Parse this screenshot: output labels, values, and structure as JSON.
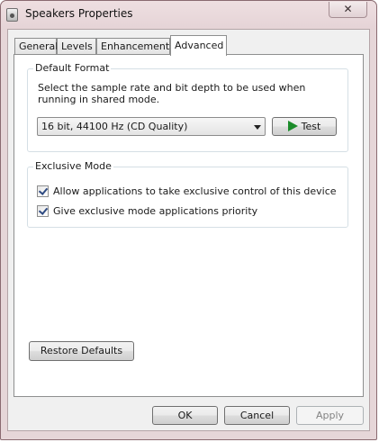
{
  "window": {
    "title": "Speakers Properties",
    "close_glyph": "✕"
  },
  "tabs": [
    {
      "label": "General",
      "active": false
    },
    {
      "label": "Levels",
      "active": false
    },
    {
      "label": "Enhancements",
      "active": false
    },
    {
      "label": "Advanced",
      "active": true
    }
  ],
  "default_format": {
    "heading": "Default Format",
    "description": "Select the sample rate and bit depth to be used when running in shared mode.",
    "selected_format": "16 bit, 44100 Hz (CD Quality)",
    "test_label": "Test",
    "test_icon": "play-icon"
  },
  "exclusive_mode": {
    "heading": "Exclusive Mode",
    "options": [
      {
        "label": "Allow applications to take exclusive control of this device",
        "checked": true
      },
      {
        "label": "Give exclusive mode applications priority",
        "checked": true
      }
    ]
  },
  "restore_defaults_label": "Restore Defaults",
  "footer": {
    "ok": "OK",
    "cancel": "Cancel",
    "apply": "Apply",
    "apply_disabled": true
  },
  "colors": {
    "frame": "#e6d6d8",
    "panel": "#ffffff",
    "play_icon": "#1c8c2b"
  }
}
